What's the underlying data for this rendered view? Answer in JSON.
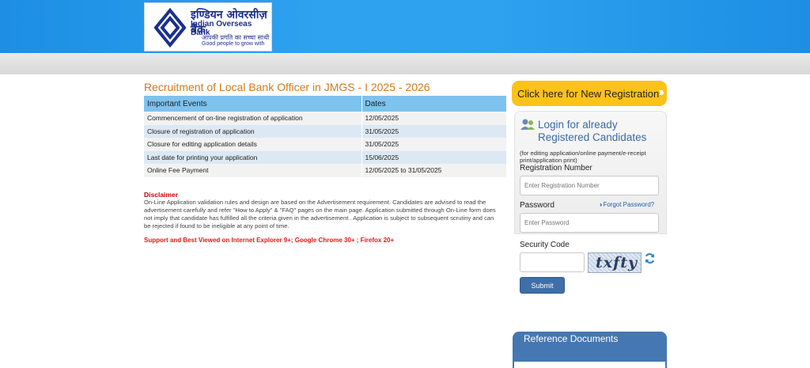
{
  "header": {
    "bank_name_hindi": "इण्डियन ओवरसीज़ बैंक",
    "bank_name": "Indian Overseas Bank",
    "tagline_hindi": "आपकी प्रगति का सच्चा साथी",
    "tagline": "Good people to grow with",
    "brand_color": "#1d8ee4"
  },
  "main": {
    "title": "Recruitment of Local Bank Officer in JMGS - I 2025 - 2026",
    "table": {
      "headers": [
        "Important Events",
        "Dates"
      ],
      "rows": [
        [
          "Commencement of on-line registration of application",
          "12/05/2025"
        ],
        [
          "Closure of registration of application",
          "31/05/2025"
        ],
        [
          "Closure for editing application details",
          "31/05/2025"
        ],
        [
          "Last date for printing your application",
          "15/06/2025"
        ],
        [
          "Online Fee Payment",
          "12/05/2025 to 31/05/2025"
        ]
      ]
    },
    "disclaimer_title": "Disclaimer",
    "disclaimer_text": "On-Line Application validation rules and design are based on the Advertisement requirement. Candidates are advised to read the advertisement carefully and refer \"How to Apply\" & \"FAQ\" pages on the main page. Application submitted through On-Line form does not imply that candidate has fulfilled all the criteria given in the advertisement . Application is subject to subsequent scrutiny and can be rejected if found to be ineligible at any point of time.",
    "support_text": "Support and Best Viewed on Internet Explorer 9+; Google Chrome 30+ ; Firefox 20+"
  },
  "sidebar": {
    "new_registration": "Click here for New Registration",
    "login_title": "Login for already Registered Candidates",
    "login_note": "(for editing application/online payment/e-receipt print/application print)",
    "registration_label": "Registration Number",
    "registration_placeholder": "Enter Registration Number",
    "password_label": "Password",
    "forgot_password": "Forgot Password?",
    "password_placeholder": "Enter Password",
    "security_label": "Security Code",
    "captcha_text": "txfty",
    "submit_label": "Submit",
    "reference_docs": "Reference Documents"
  }
}
